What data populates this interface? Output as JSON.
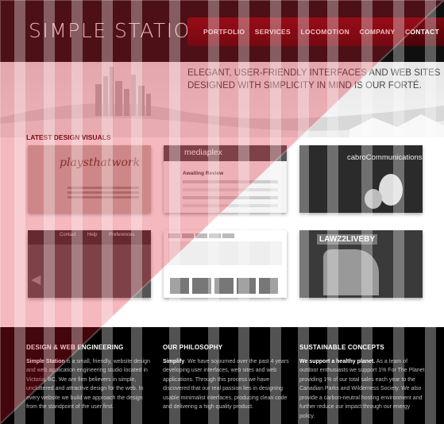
{
  "header": {
    "logo": "SIMPLE STATION",
    "nav": [
      "PORTFOLIO",
      "SERVICES",
      "LOCOMOTION",
      "COMPANY",
      "CONTACT"
    ]
  },
  "hero": {
    "tagline_1": "ELEGANT, USER-FRIENDLY INTERFACES AND WEB SITES",
    "tagline_2": "DESIGNED WITH SIMPLICITY IN MIND IS OUR FORTÉ."
  },
  "latest": {
    "title": "LATEST DESIGN VISUALS",
    "thumb1_text": "playsthatwork",
    "thumb2_brand": "mediaplex",
    "thumb2_heading": "Awaiting Review",
    "thumb3_brand": "cabroCommunications",
    "thumb4_tabs": [
      "Contact",
      "Help",
      "Preferences"
    ],
    "thumb6_brand": "LAWZ2LIVEBY"
  },
  "footer": {
    "col1": {
      "title": "DESIGN & WEB ENGINEERING",
      "lead": "Simple Station",
      "text": "is a small, friendly, website design and web application engineering studio located in Victoria, BC. We are firm believers in simple, uncluttered and attractive design for the web. In every website we build we approach the design from the standpoint of the user first."
    },
    "col2": {
      "title": "OUR PHILOSOPHY",
      "lead": "Simplify",
      "text": ". We have sojourned over the past 4 years developing user interfaces, web sites and web applications. Through this process we have discovered that our real passion lies in designing usable minimalist interfaces, producing clean code and delivering a high quality product."
    },
    "col3": {
      "title": "SUSTAINABLE CONCEPTS",
      "lead": "We support a healthy planet.",
      "text": "As a team of outdoor enthusiasts we support 1% For The Planet providing 1% of our total sales each year to the Canadian Parks and Wilderness Society. We also provide a carbon-neutral hosting environment and further reduce our impact through our energy policy."
    }
  },
  "colors": {
    "overlay": "#d9142a",
    "nav": "#6e0a10",
    "footer_bg": "#000000"
  }
}
